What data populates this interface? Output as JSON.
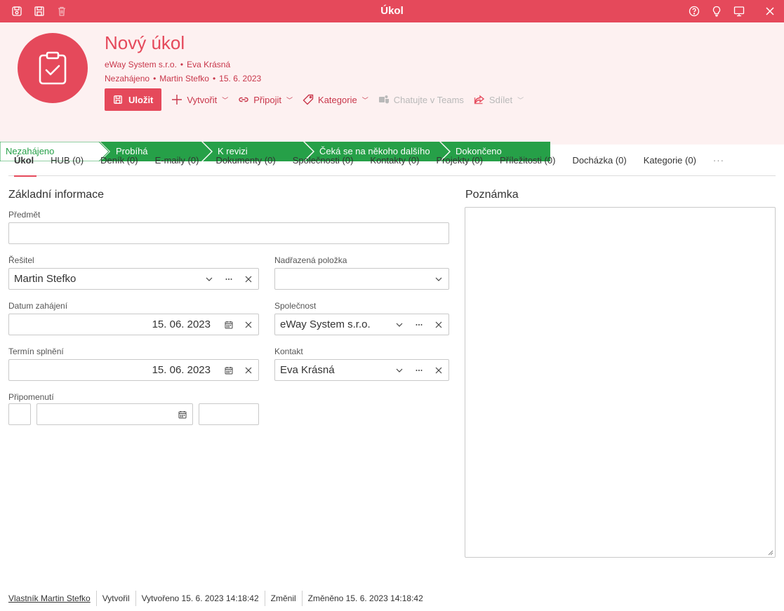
{
  "window": {
    "title": "Úkol"
  },
  "header": {
    "title": "Nový úkol",
    "company": "eWay System s.r.o.",
    "contact": "Eva Krásná",
    "state": "Nezahájeno",
    "solver": "Martin Stefko",
    "date": "15. 6. 2023",
    "separator": "•"
  },
  "actions": {
    "save": "Uložit",
    "create": "Vytvořit",
    "attach": "Připojit",
    "category": "Kategorie",
    "teams": "Chatujte v Teams",
    "share": "Sdílet"
  },
  "status_steps": [
    "Nezahájeno",
    "Probíhá",
    "K revizi",
    "Čeká se na někoho dalšího",
    "Dokončeno"
  ],
  "tabs": [
    "Úkol",
    "HUB (0)",
    "Deník (0)",
    "E-maily (0)",
    "Dokumenty (0)",
    "Společnosti (0)",
    "Kontakty (0)",
    "Projekty (0)",
    "Příležitosti (0)",
    "Docházka (0)",
    "Kategorie (0)",
    "···"
  ],
  "form": {
    "section_title": "Základní informace",
    "subject_label": "Předmět",
    "subject_value": "",
    "solver_label": "Řešitel",
    "solver_value": "Martin Stefko",
    "parent_label": "Nadřazená položka",
    "parent_value": "",
    "start_label": "Datum zahájení",
    "start_value": "15. 06. 2023",
    "company_label": "Společnost",
    "company_value": "eWay System s.r.o.",
    "due_label": "Termín splnění",
    "due_value": "15. 06. 2023",
    "contact_label": "Kontakt",
    "contact_value": "Eva Krásná",
    "reminder_label": "Připomenutí"
  },
  "note": {
    "title": "Poznámka"
  },
  "footer": {
    "owner": "Vlastník Martin Stefko",
    "created_by": "Vytvořil",
    "created": "Vytvořeno 15. 6. 2023 14:18:42",
    "changed_by": "Změnil",
    "changed": "Změněno 15. 6. 2023 14:18:42"
  },
  "colors": {
    "accent": "#e5495b",
    "status_green": "#26a048",
    "header_bg": "#fdf1f1"
  }
}
